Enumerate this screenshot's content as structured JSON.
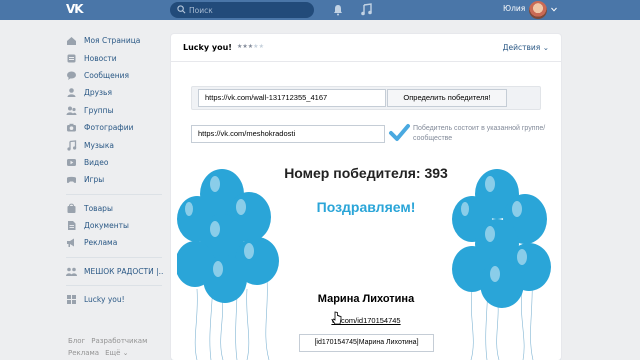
{
  "topbar": {
    "logo": "VK",
    "search_placeholder": "Поиск",
    "user_name": "Юлия"
  },
  "sidebar": {
    "items": [
      {
        "label": "Моя Страница",
        "icon": "home-icon"
      },
      {
        "label": "Новости",
        "icon": "news-icon"
      },
      {
        "label": "Сообщения",
        "icon": "messages-icon"
      },
      {
        "label": "Друзья",
        "icon": "friends-icon"
      },
      {
        "label": "Группы",
        "icon": "groups-icon"
      },
      {
        "label": "Фотографии",
        "icon": "camera-icon"
      },
      {
        "label": "Музыка",
        "icon": "music-icon"
      },
      {
        "label": "Видео",
        "icon": "video-icon"
      },
      {
        "label": "Игры",
        "icon": "games-icon"
      }
    ],
    "items2": [
      {
        "label": "Товары",
        "icon": "goods-icon"
      },
      {
        "label": "Документы",
        "icon": "documents-icon"
      },
      {
        "label": "Реклама",
        "icon": "ads-icon"
      }
    ],
    "items3": [
      {
        "label": "МЕШОК РАДОСТИ |..",
        "icon": "community-icon"
      }
    ],
    "items4": [
      {
        "label": "Lucky you!",
        "icon": "app-icon"
      }
    ],
    "footer": {
      "blog": "Блог",
      "devs": "Разработчикам",
      "ads": "Реклама",
      "more": "Ещё ⌄"
    }
  },
  "app": {
    "title": "Lucky you!",
    "rating": 3,
    "actions_label": "Действия ⌄",
    "post_url": "https://vk.com/wall-131712355_4167",
    "winner_button": "Определить победителя!",
    "group_url": "https://vk.com/meshokradosti",
    "check_label": "Победитель состоит в указанной группе/сообществе",
    "winner_number": "Номер победителя: 393",
    "congrats": "Поздравляем!",
    "winner_name": "Марина Лихотина",
    "winner_link": "vk.com/id170154745",
    "mention": "[id170154745|Марина Лихотина]"
  },
  "colors": {
    "topbar": "#4a76a8",
    "link": "#2a5885",
    "balloon": "#2aa5d8",
    "check": "#4aa9e0"
  }
}
